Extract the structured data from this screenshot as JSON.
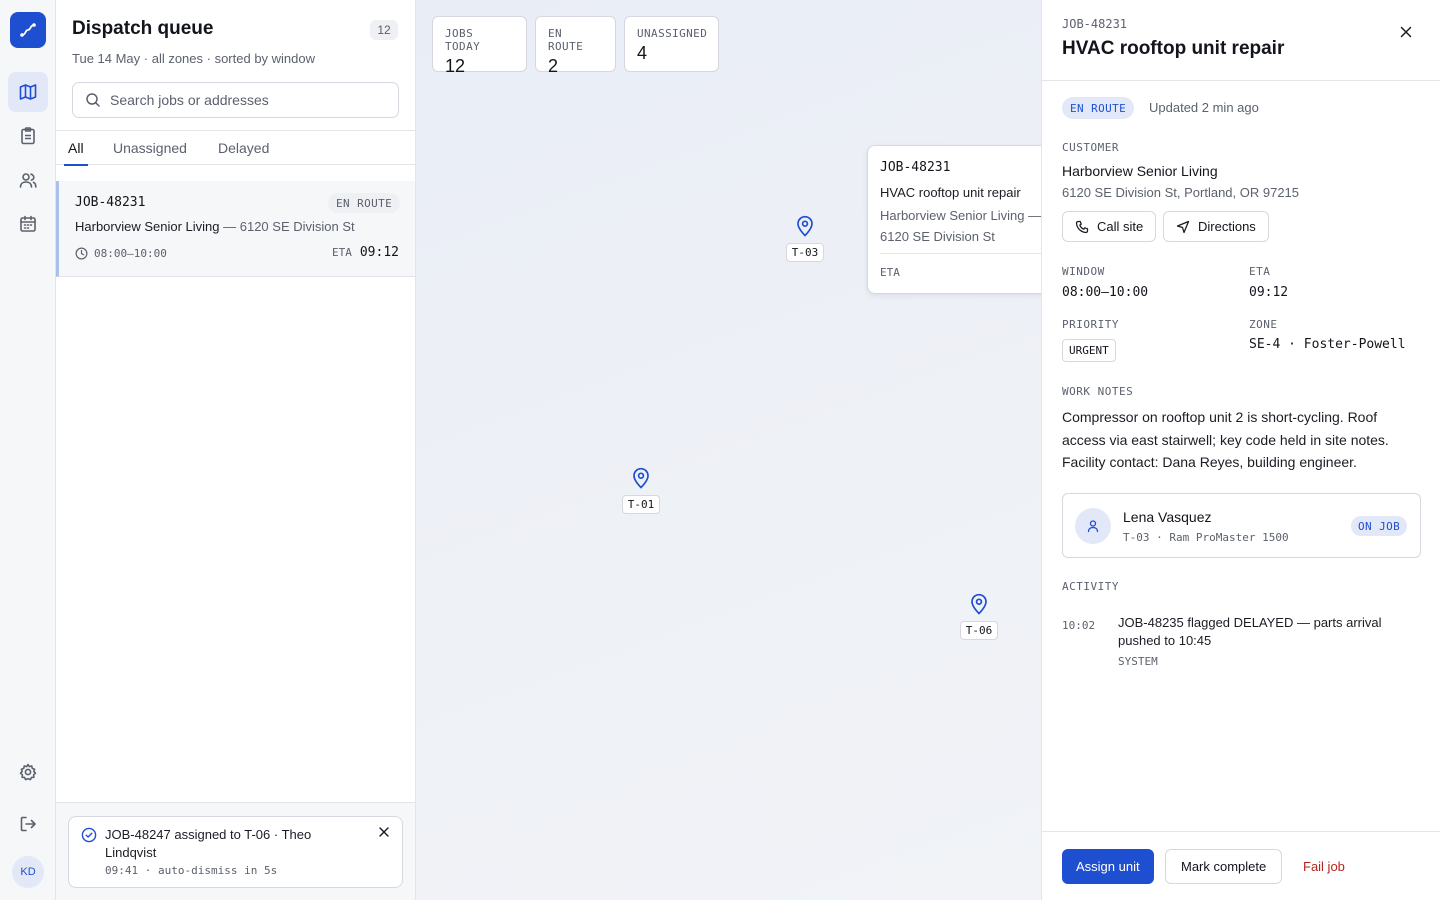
{
  "user": {
    "initials": "KD"
  },
  "queue": {
    "title": "Dispatch queue",
    "count": "12",
    "subtitle": "Tue 14 May · all zones · sorted by window",
    "search_placeholder": "Search jobs or addresses",
    "tabs": [
      {
        "label": "All",
        "active": true
      },
      {
        "label": "Unassigned",
        "active": false
      },
      {
        "label": "Delayed",
        "active": false
      }
    ],
    "jobs": [
      {
        "id": "JOB-48231",
        "status": "EN ROUTE",
        "customer": "Harborview Senior Living",
        "address": " — 6120 SE Division St",
        "window": "08:00–10:00",
        "eta_label": "ETA",
        "eta": "09:12"
      }
    ]
  },
  "toast": {
    "message": "JOB-48247 assigned to T-06 · Theo Lindqvist",
    "meta": "09:41 · auto-dismiss in 5s"
  },
  "map": {
    "stats": [
      {
        "label": "JOBS TODAY",
        "value": "12"
      },
      {
        "label": "EN ROUTE",
        "value": "2"
      },
      {
        "label": "UNASSIGNED",
        "value": "4"
      }
    ],
    "pins": [
      {
        "label": "T-03"
      },
      {
        "label": "T-01"
      },
      {
        "label": "T-06"
      }
    ],
    "popup": {
      "id": "JOB-48231",
      "title": "HVAC rooftop unit repair",
      "address": "Harborview Senior Living — 6120 SE Division St",
      "eta_label": "ETA"
    }
  },
  "detail": {
    "id": "JOB-48231",
    "title": "HVAC rooftop unit repair",
    "status": "EN ROUTE",
    "updated": "Updated 2 min ago",
    "customer_label": "CUSTOMER",
    "customer": "Harborview Senior Living",
    "address": "6120 SE Division St, Portland, OR 97215",
    "call_label": "Call site",
    "directions_label": "Directions",
    "window_label": "WINDOW",
    "window": "08:00–10:00",
    "eta_label": "ETA",
    "eta": "09:12",
    "priority_label": "PRIORITY",
    "priority": "URGENT",
    "zone_label": "ZONE",
    "zone": "SE-4 · Foster-Powell",
    "notes_label": "WORK NOTES",
    "notes": "Compressor on rooftop unit 2 is short-cycling. Roof access via east stairwell; key code held in site notes. Facility contact: Dana Reyes, building engineer.",
    "technician": {
      "name": "Lena Vasquez",
      "meta": "T-03 · Ram ProMaster 1500",
      "status": "ON JOB"
    },
    "activity_label": "ACTIVITY",
    "activity": [
      {
        "time": "10:02",
        "text": "JOB-48235 flagged DELAYED — parts arrival pushed to 10:45",
        "source": "SYSTEM"
      }
    ],
    "actions": {
      "assign": "Assign unit",
      "complete": "Mark complete",
      "fail": "Fail job"
    }
  },
  "colors": {
    "accent": "#1f4fd1",
    "accent_soft": "#e2e8f7",
    "danger": "#b3261e",
    "muted_text": "#5b616d"
  }
}
